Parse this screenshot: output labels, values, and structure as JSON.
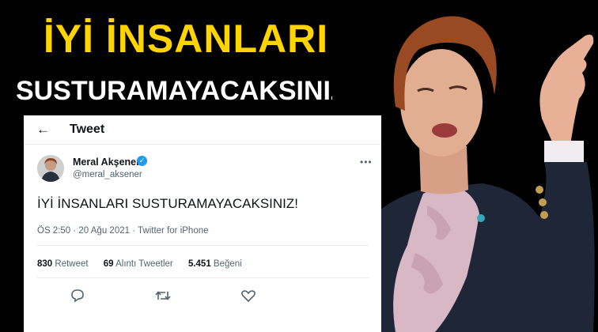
{
  "headline": {
    "line1": "İYİ İNSANLARI",
    "line2": "SUSTURAMAYACAKSINIZ!"
  },
  "tweet": {
    "header_title": "Tweet",
    "author_name": "Meral Akşener",
    "author_handle": "@meral_aksener",
    "text": "İYİ İNSANLARI SUSTURAMAYACAKSINIZ!",
    "meta": "ÖS 2:50 · 20 Ağu 2021 · Twitter for iPhone",
    "stats": {
      "retweet_count": "830",
      "retweet_label": "Retweet",
      "quote_count": "69",
      "quote_label": "Alıntı Tweetler",
      "like_count": "5.451",
      "like_label": "Beğeni"
    }
  },
  "colors": {
    "headline_yellow": "#ffd400",
    "background": "#000000",
    "verified_blue": "#1d9bf0",
    "secondary_text": "#536471"
  },
  "icons": [
    "back-arrow-icon",
    "verified-badge-icon",
    "more-icon",
    "reply-icon",
    "retweet-icon",
    "like-icon"
  ]
}
